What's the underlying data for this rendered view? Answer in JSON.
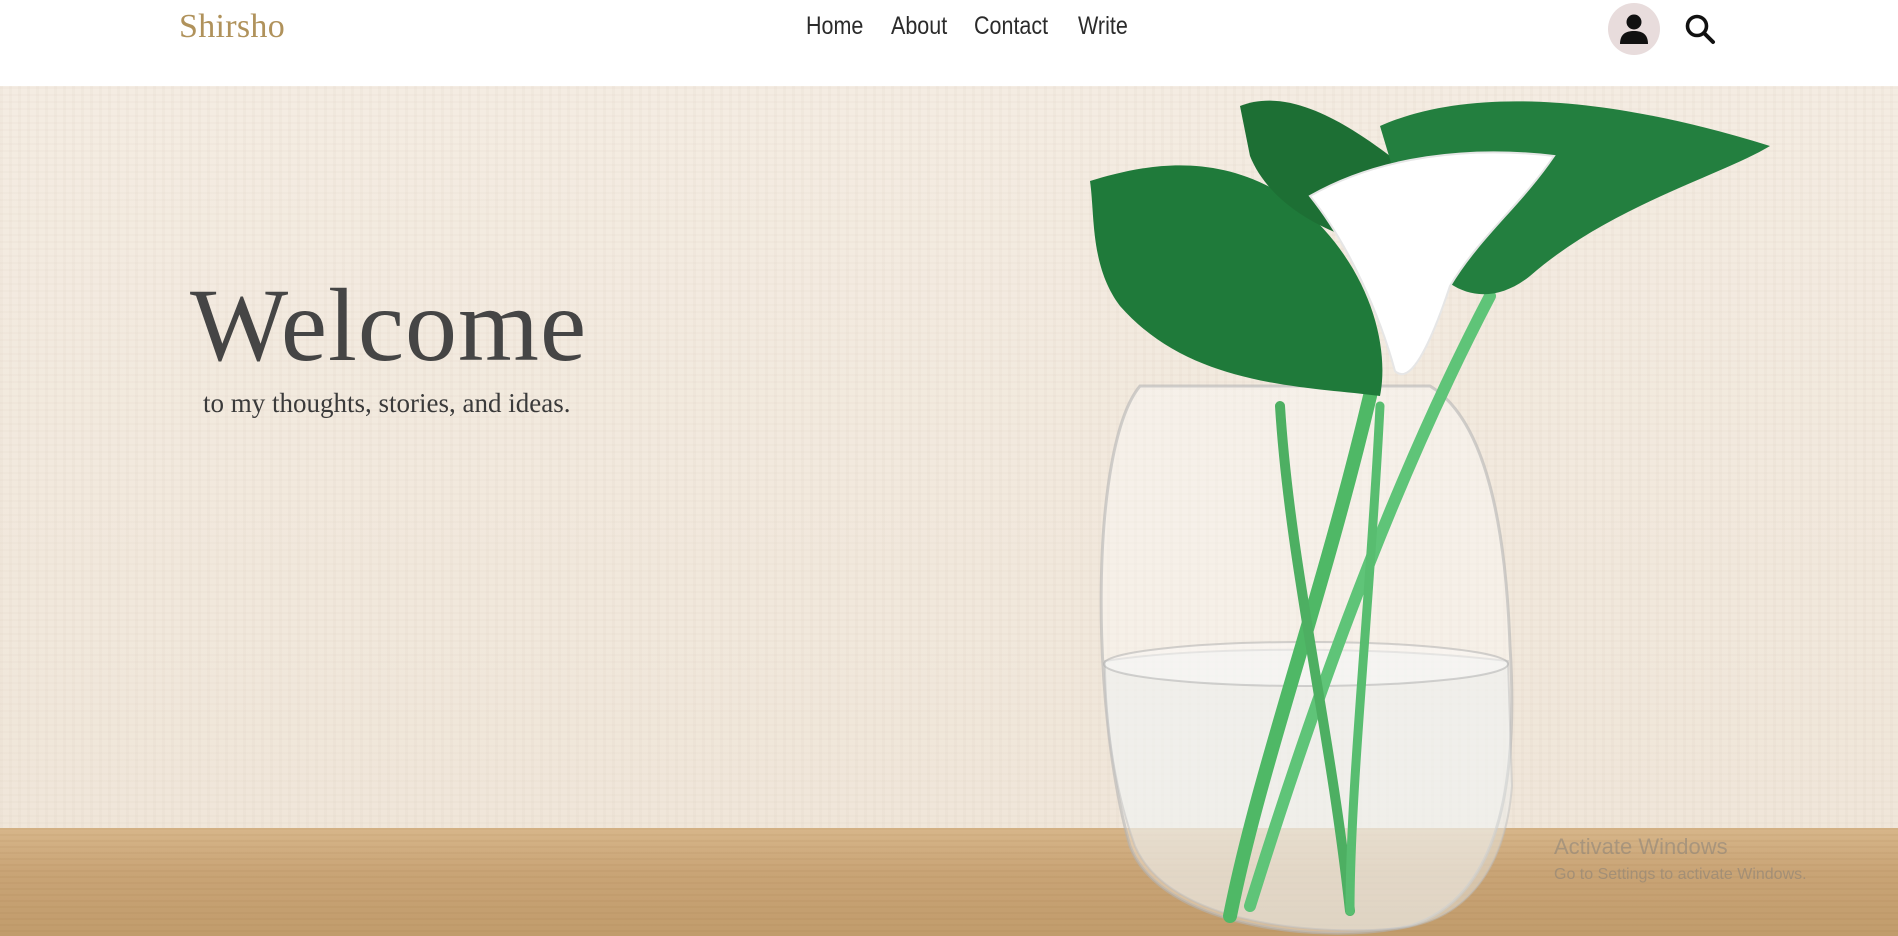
{
  "header": {
    "brand": "Shirsho",
    "nav": [
      "Home",
      "About",
      "Contact",
      "Write"
    ],
    "avatar_icon": "user-icon",
    "search_icon": "search-icon"
  },
  "hero": {
    "title": "Welcome",
    "subtitle": "to my thoughts, stories, and ideas."
  },
  "watermark": {
    "title": "Activate Windows",
    "subtitle": "Go to Settings to activate Windows."
  },
  "colors": {
    "brand": "#b0925b",
    "nav_text": "#2b2b2b",
    "avatar_bg": "#e8dcdc",
    "hero_text": "#454545"
  }
}
